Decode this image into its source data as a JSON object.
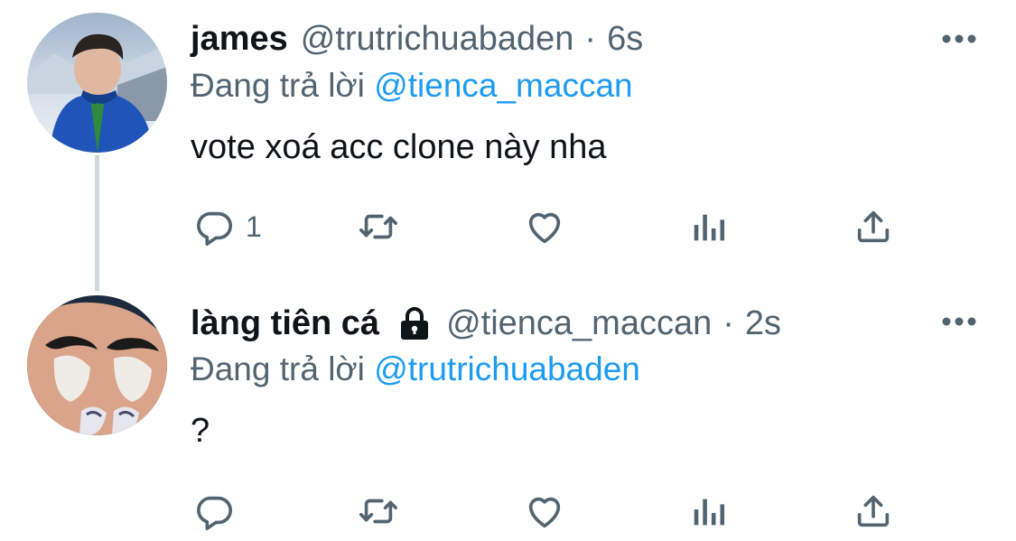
{
  "tweets": [
    {
      "display_name": "james",
      "handle": "@trutrichuabaden",
      "separator": "·",
      "time": "6s",
      "reply_prefix": "Đang trả lời",
      "reply_target": "@tienca_maccan",
      "text": "vote xoá acc clone này nha",
      "reply_count": "1",
      "locked": false
    },
    {
      "display_name": "làng tiên cá",
      "handle": "@tienca_maccan",
      "separator": "·",
      "time": "2s",
      "reply_prefix": "Đang trả lời",
      "reply_target": "@trutrichuabaden",
      "text": "?",
      "reply_count": "",
      "locked": true
    }
  ],
  "icons": {
    "more": "more-horizontal-icon",
    "reply": "reply-bubble-icon",
    "retweet": "retweet-icon",
    "like": "heart-icon",
    "analytics": "analytics-bars-icon",
    "share": "share-upload-icon",
    "lock": "lock-icon"
  },
  "colors": {
    "text_primary": "#0f1419",
    "text_secondary": "#536471",
    "link": "#1d9bf0",
    "thread_line": "#cfd9de"
  }
}
